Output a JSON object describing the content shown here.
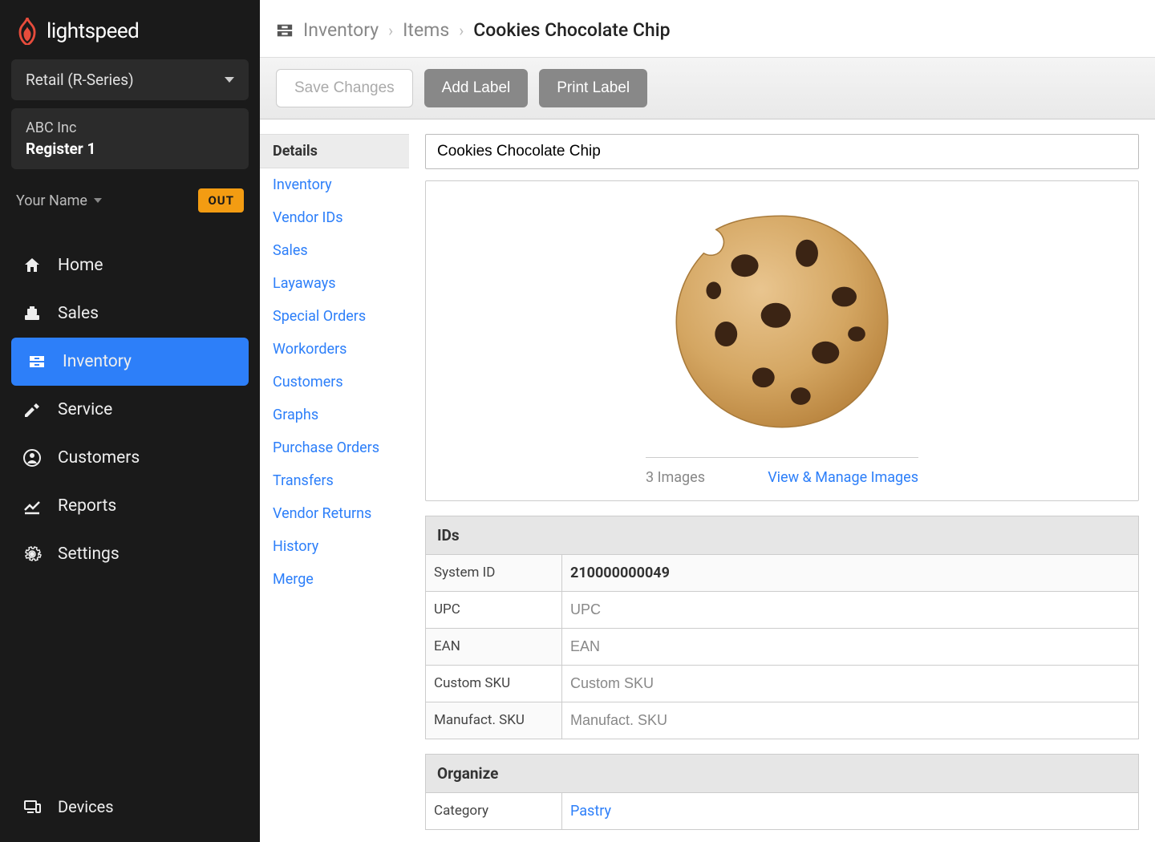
{
  "brand": {
    "name": "lightspeed"
  },
  "sidebar": {
    "series_label": "Retail (R-Series)",
    "company": "ABC Inc",
    "register": "Register 1",
    "user_name": "Your Name",
    "out_badge": "OUT",
    "nav": [
      {
        "label": "Home"
      },
      {
        "label": "Sales"
      },
      {
        "label": "Inventory"
      },
      {
        "label": "Service"
      },
      {
        "label": "Customers"
      },
      {
        "label": "Reports"
      },
      {
        "label": "Settings"
      }
    ],
    "devices_label": "Devices"
  },
  "breadcrumb": {
    "seg1": "Inventory",
    "seg2": "Items",
    "current": "Cookies Chocolate Chip"
  },
  "toolbar": {
    "save": "Save Changes",
    "add_label": "Add Label",
    "print_label": "Print Label"
  },
  "subnav": [
    "Details",
    "Inventory",
    "Vendor IDs",
    "Sales",
    "Layaways",
    "Special Orders",
    "Workorders",
    "Customers",
    "Graphs",
    "Purchase Orders",
    "Transfers",
    "Vendor Returns",
    "History",
    "Merge"
  ],
  "detail": {
    "item_name": "Cookies Chocolate Chip",
    "image_count": "3 Images",
    "image_manage": "View & Manage Images",
    "ids_header": "IDs",
    "ids": {
      "system_id_label": "System ID",
      "system_id_value": "210000000049",
      "upc_label": "UPC",
      "upc_placeholder": "UPC",
      "ean_label": "EAN",
      "ean_placeholder": "EAN",
      "custom_sku_label": "Custom SKU",
      "custom_sku_placeholder": "Custom SKU",
      "manuf_sku_label": "Manufact. SKU",
      "manuf_sku_placeholder": "Manufact. SKU"
    },
    "organize_header": "Organize",
    "organize": {
      "category_label": "Category",
      "category_value": "Pastry"
    }
  }
}
